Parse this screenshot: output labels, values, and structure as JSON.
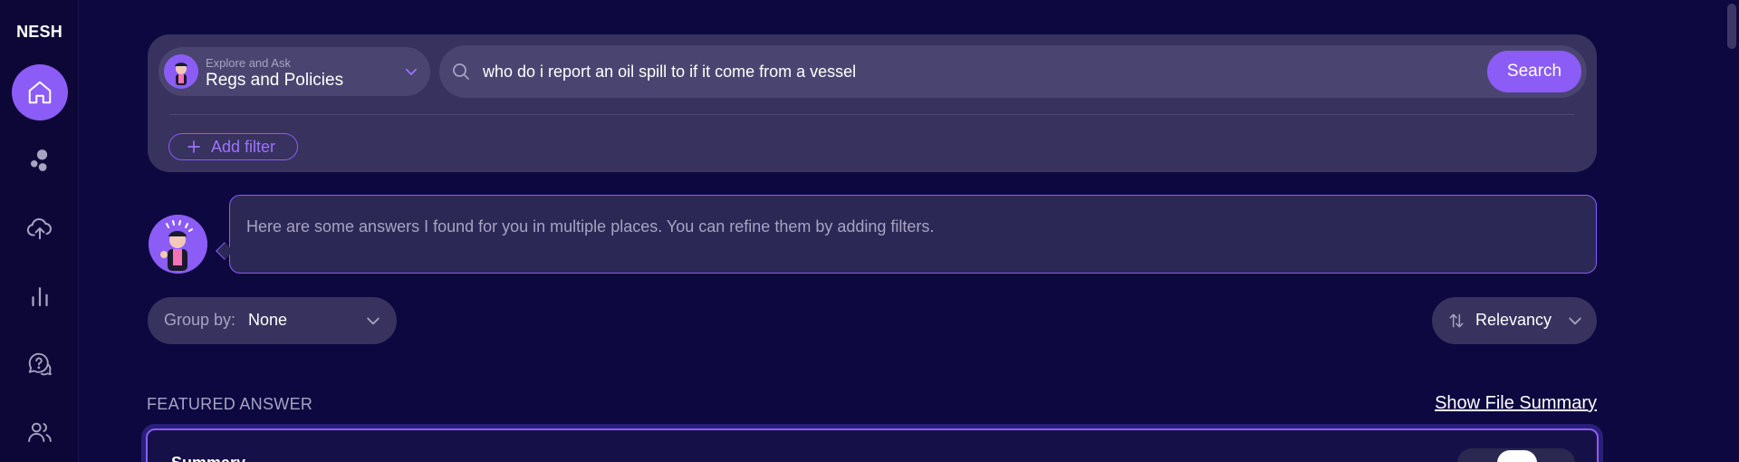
{
  "app": {
    "logo": "NESH"
  },
  "sidebar": {
    "items": [
      {
        "icon": "home-icon",
        "active": true
      },
      {
        "icon": "bubbles-icon",
        "active": false
      },
      {
        "icon": "upload-icon",
        "active": false
      },
      {
        "icon": "bar-chart-icon",
        "active": false
      },
      {
        "icon": "help-chat-icon",
        "active": false
      },
      {
        "icon": "users-icon",
        "active": false
      }
    ]
  },
  "search": {
    "source_sub": "Explore and Ask",
    "source_main": "Regs and Policies",
    "query": "who do i report an oil spill to if it come from a vessel",
    "button_label": "Search",
    "add_filter_label": "Add filter"
  },
  "assistant": {
    "message": "Here are some answers I found for you in multiple places. You can refine them by adding filters."
  },
  "controls": {
    "group_by_label": "Group by:",
    "group_by_value": "None",
    "sort_label": "Relevancy"
  },
  "featured": {
    "section_label": "FEATURED ANSWER",
    "show_summary_label": "Show File Summary",
    "card_title": "Summary"
  },
  "colors": {
    "background": "#0d0840",
    "accent": "#8b5cf6",
    "panel": "#37325e"
  }
}
